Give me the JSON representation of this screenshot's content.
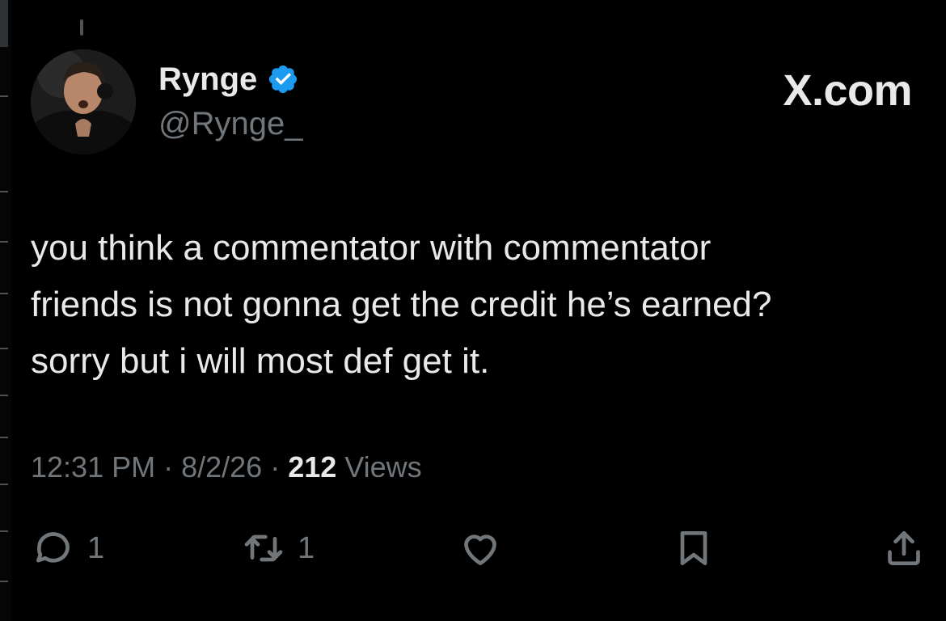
{
  "author": {
    "display_name": "Rynge",
    "handle": "@Rynge_",
    "verified": true
  },
  "brand": {
    "site": "X.com"
  },
  "tweet": {
    "lines": [
      "you think a commentator with commentator",
      "friends is not gonna get the credit he’s earned?",
      "sorry but i will most def get it."
    ]
  },
  "meta": {
    "time": "12:31 PM",
    "separator": " · ",
    "date": "8/2/26",
    "views_count": "212",
    "views_label": " Views"
  },
  "actions": {
    "reply_count": "1",
    "retweet_count": "1"
  },
  "colors": {
    "background": "#000000",
    "text": "#e7e9ea",
    "muted": "#71767b",
    "verified": "#1d9bf0"
  },
  "icons": {
    "reply": "reply-icon",
    "retweet": "retweet-icon",
    "like": "heart-icon",
    "bookmark": "bookmark-icon",
    "share": "share-icon",
    "verified": "verified-badge-icon"
  }
}
